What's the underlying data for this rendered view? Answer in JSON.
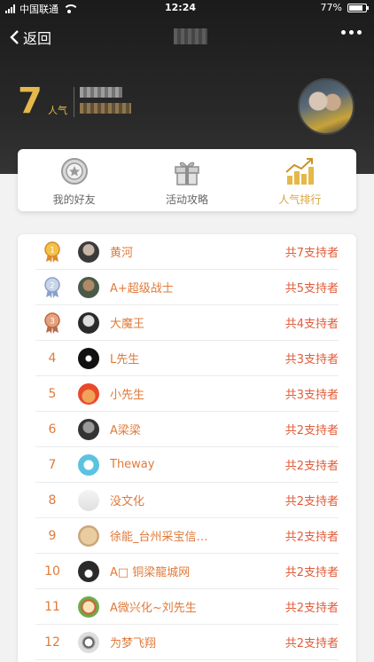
{
  "status": {
    "carrier": "中国联通",
    "time": "12:24",
    "battery": "77%"
  },
  "nav": {
    "back_label": "返回"
  },
  "me": {
    "rank": "7",
    "rank_label": "人气"
  },
  "tabs": [
    {
      "label": "我的好友",
      "icon": "friends-badge-icon",
      "active": false
    },
    {
      "label": "活动攻略",
      "icon": "gift-icon",
      "active": false
    },
    {
      "label": "人气排行",
      "icon": "bar-chart-trend-icon",
      "active": true
    }
  ],
  "colors": {
    "accent": "#e4b84a",
    "active_tab": "#d9a441",
    "list_text": "#e07a3a",
    "count_text": "#e05c3a"
  },
  "ranking": [
    {
      "rank": "1",
      "name": "黄河",
      "count": "共7支持者",
      "medal": "gold"
    },
    {
      "rank": "2",
      "name": "A+超级战士",
      "count": "共5支持者",
      "medal": "silver"
    },
    {
      "rank": "3",
      "name": "大魔王",
      "count": "共4支持者",
      "medal": "bronze"
    },
    {
      "rank": "4",
      "name": "L先生",
      "count": "共3支持者"
    },
    {
      "rank": "5",
      "name": "小先生",
      "count": "共3支持者"
    },
    {
      "rank": "6",
      "name": "A梁梁",
      "count": "共2支持者"
    },
    {
      "rank": "7",
      "name": "Theway",
      "count": "共2支持者"
    },
    {
      "rank": "8",
      "name": "没文化",
      "count": "共2支持者"
    },
    {
      "rank": "9",
      "name": "徐能_台州采宝信…",
      "count": "共2支持者"
    },
    {
      "rank": "10",
      "name": "A□ 铜梁龍城网",
      "count": "共2支持者"
    },
    {
      "rank": "11",
      "name": "A微兴化~刘先生",
      "count": "共2支持者"
    },
    {
      "rank": "12",
      "name": "为梦飞翔",
      "count": "共2支持者"
    }
  ]
}
